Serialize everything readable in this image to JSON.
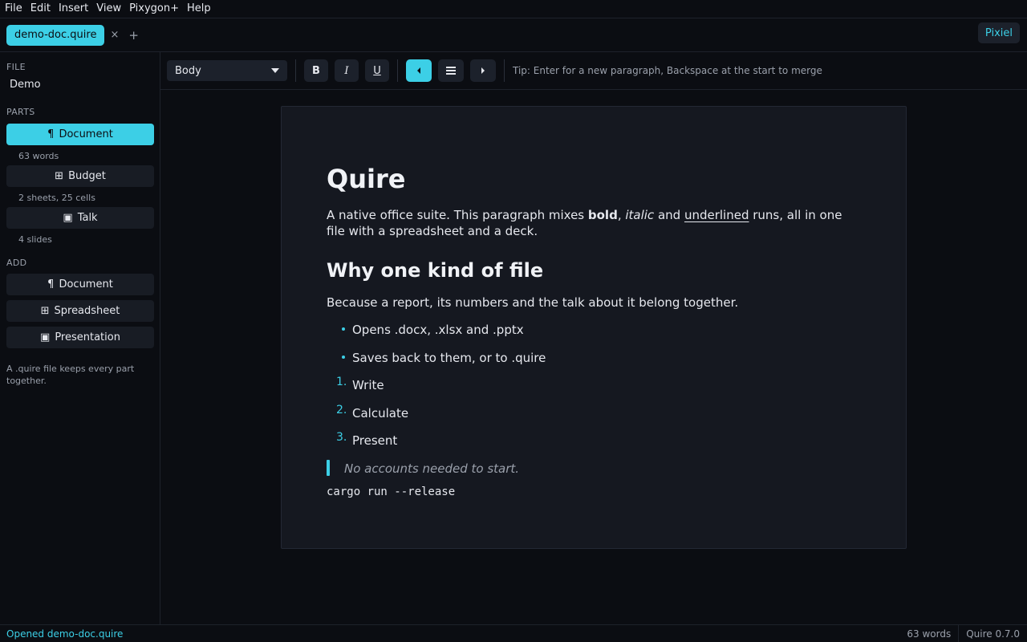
{
  "menubar": {
    "items": [
      "File",
      "Edit",
      "Insert",
      "View",
      "Pixygon+",
      "Help"
    ]
  },
  "tabs": {
    "active": "demo-doc.quire",
    "close_glyph": "×",
    "add_glyph": "+"
  },
  "account_badge": "Pixiel",
  "sidebar": {
    "file_heading": "FILE",
    "file_name": "Demo",
    "parts_heading": "PARTS",
    "parts": [
      {
        "icon": "pilcrow-icon",
        "glyph": "¶",
        "label": "Document",
        "meta": "63 words",
        "active": true
      },
      {
        "icon": "spreadsheet-icon",
        "glyph": "⊞",
        "label": "Budget",
        "meta": "2 sheets, 25 cells",
        "active": false
      },
      {
        "icon": "presentation-icon",
        "glyph": "▣",
        "label": "Talk",
        "meta": "4 slides",
        "active": false
      }
    ],
    "add_heading": "ADD",
    "add_items": [
      {
        "icon": "pilcrow-icon",
        "glyph": "¶",
        "label": "Document"
      },
      {
        "icon": "spreadsheet-icon",
        "glyph": "⊞",
        "label": "Spreadsheet"
      },
      {
        "icon": "presentation-icon",
        "glyph": "▣",
        "label": "Presentation"
      }
    ],
    "note": "A .quire file keeps every part together."
  },
  "toolbar": {
    "style_value": "Body",
    "bold": "B",
    "italic": "I",
    "underline": "U",
    "tip": "Tip: Enter for a new paragraph, Backspace at the start to merge"
  },
  "document": {
    "title": "Quire",
    "intro": {
      "before": "A native office suite. This paragraph mixes ",
      "bold": "bold",
      "comma": ", ",
      "italic": "italic",
      "and": " and ",
      "underlined": "underlined",
      "after": " runs, all in one file with a spreadsheet and a deck."
    },
    "heading2": "Why one kind of file",
    "para2": "Because a report, its numbers and the talk about it belong together.",
    "bullets": [
      "Opens .docx, .xlsx and .pptx",
      "Saves back to them, or to .quire"
    ],
    "numbered": [
      {
        "n": "1.",
        "text": "Write"
      },
      {
        "n": "2.",
        "text": "Calculate"
      },
      {
        "n": "3.",
        "text": "Present"
      }
    ],
    "quote": "No accounts needed to start.",
    "code": "cargo run --release"
  },
  "status": {
    "message": "Opened demo-doc.quire",
    "word_count": "63 words",
    "version": "Quire 0.7.0"
  },
  "colors": {
    "accent": "#3ccfe6",
    "background": "#0b0d12",
    "page": "#151820"
  }
}
